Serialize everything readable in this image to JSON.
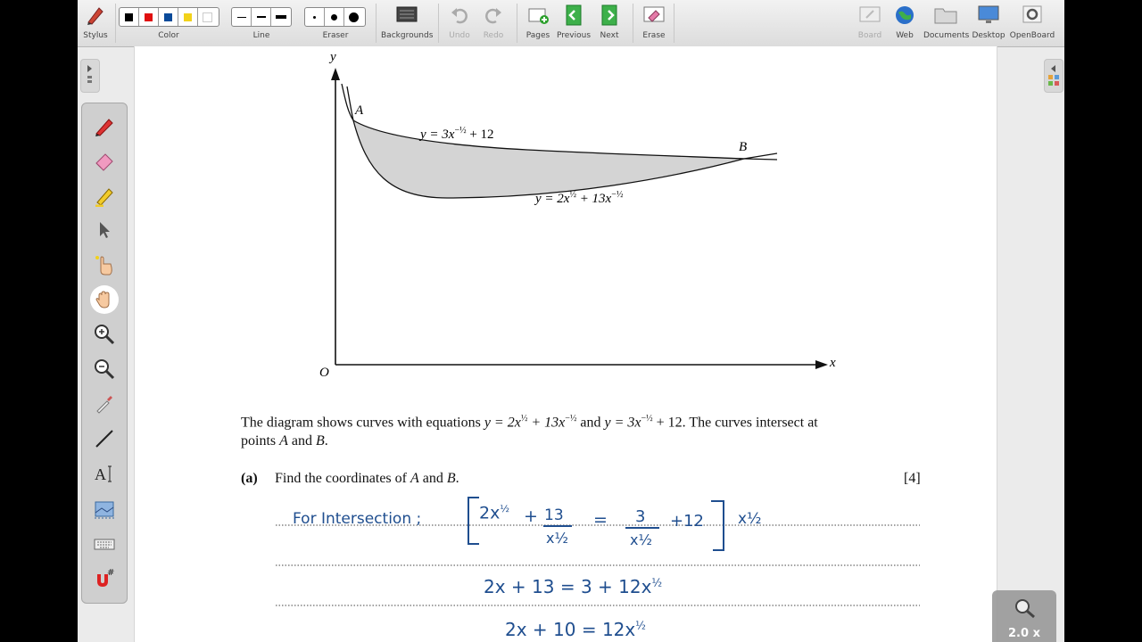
{
  "toolbar": {
    "stylus": "Stylus",
    "color": "Color",
    "line": "Line",
    "eraser": "Eraser",
    "backgrounds": "Backgrounds",
    "undo": "Undo",
    "redo": "Redo",
    "pages": "Pages",
    "previous": "Previous",
    "next": "Next",
    "erase": "Erase",
    "board": "Board",
    "web": "Web",
    "documents": "Documents",
    "desktop": "Desktop",
    "openboard": "OpenBoard",
    "colors": [
      "#000000",
      "#e01010",
      "#0a4a9a",
      "#f2d21a",
      "#ffffff"
    ]
  },
  "palette": {
    "icons": [
      "pen-icon",
      "eraser-icon",
      "highlighter-icon",
      "pointer-icon",
      "laser-pointer-icon",
      "hand-icon",
      "zoom-in-icon",
      "zoom-out-icon",
      "eyedropper-icon",
      "line-tool-icon",
      "text-tool-icon",
      "capture-icon",
      "keyboard-icon",
      "magnet-grid-icon"
    ]
  },
  "diagram": {
    "y_axis": "y",
    "x_axis": "x",
    "origin": "O",
    "point_a": "A",
    "point_b": "B",
    "curve1_label": "y = 3x",
    "curve1_exp": "−½",
    "curve1_tail": " + 12",
    "curve2_label": "y = 2x",
    "curve2_exp1": "½",
    "curve2_mid": " + 13x",
    "curve2_exp2": "−½"
  },
  "question": {
    "intro_1": "The diagram shows curves with equations ",
    "eq1a": "y = 2x",
    "eq1_exp1": "½",
    "eq1b": " + 13x",
    "eq1_exp2": "−½",
    "and": " and ",
    "eq2a": "y = 3x",
    "eq2_exp": "−½",
    "eq2b": " + 12.",
    "intro_2": "  The curves intersect at",
    "intro_3": "points ",
    "pa": "A",
    "and2": " and ",
    "pb": "B",
    "period": ".",
    "part_label": "(a)",
    "part_text_1": "Find the coordinates of ",
    "part_a": "A",
    "part_and": " and ",
    "part_b": "B",
    "part_dot": ".",
    "marks": "[4]"
  },
  "handwriting": {
    "line1_lead": "For Intersection ;",
    "line1_a": "2x",
    "line1_a_exp": "½",
    "line1_plus": "+",
    "line1_13": "13",
    "line1_den1": "x½",
    "line1_eq": "=",
    "line1_3": "3",
    "line1_den2": "x½",
    "line1_plus12": "+12",
    "line1_mult": "x½",
    "line2": "2x + 13  =  3 + 12x",
    "line2_exp": "½",
    "line3": "2x + 10  =  12x",
    "line3_exp": "½"
  },
  "zoom": {
    "level": "2.0 x"
  },
  "colors": {
    "ink": "#1f4e8f",
    "shade": "#d4d4d4",
    "toolbar_bg": "#e6e6e6"
  }
}
